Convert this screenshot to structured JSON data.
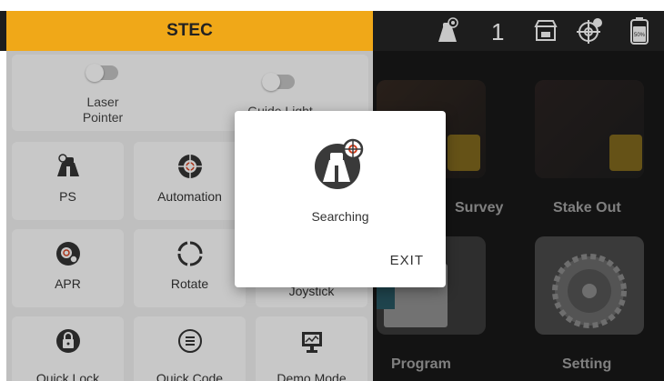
{
  "header": {
    "title": "STEC",
    "status_count": "1"
  },
  "status_icons": [
    "survey-mode-icon",
    "store-icon",
    "satellite-icon",
    "battery-icon"
  ],
  "battery": {
    "level": "50%"
  },
  "toggles": [
    {
      "label": "Laser\nPointer",
      "on": false
    },
    {
      "label": "Guide Light",
      "on": false
    }
  ],
  "grid": [
    {
      "label": "PS",
      "icon": "binoculars-icon"
    },
    {
      "label": "Automation",
      "icon": "target-icon"
    },
    {
      "label": "Joystick",
      "icon": "joystick-icon"
    },
    {
      "label": "APR",
      "icon": "apr-search-icon"
    },
    {
      "label": "Rotate",
      "icon": "rotate-icon"
    },
    {
      "label": "Quick Lock",
      "icon": "lock-icon"
    },
    {
      "label": "Quick Code",
      "icon": "list-icon"
    },
    {
      "label": "Demo Mode",
      "icon": "demo-icon"
    }
  ],
  "home_tiles": [
    {
      "label": "Survey"
    },
    {
      "label": "Stake Out"
    },
    {
      "label": "Program"
    },
    {
      "label": "Setting"
    }
  ],
  "dialog": {
    "message": "Searching",
    "exit_label": "EXIT"
  },
  "colors": {
    "accent": "#f0a818",
    "topbar": "#1d1d1d",
    "icon_dark": "#333333",
    "icon_red": "#d04020"
  }
}
